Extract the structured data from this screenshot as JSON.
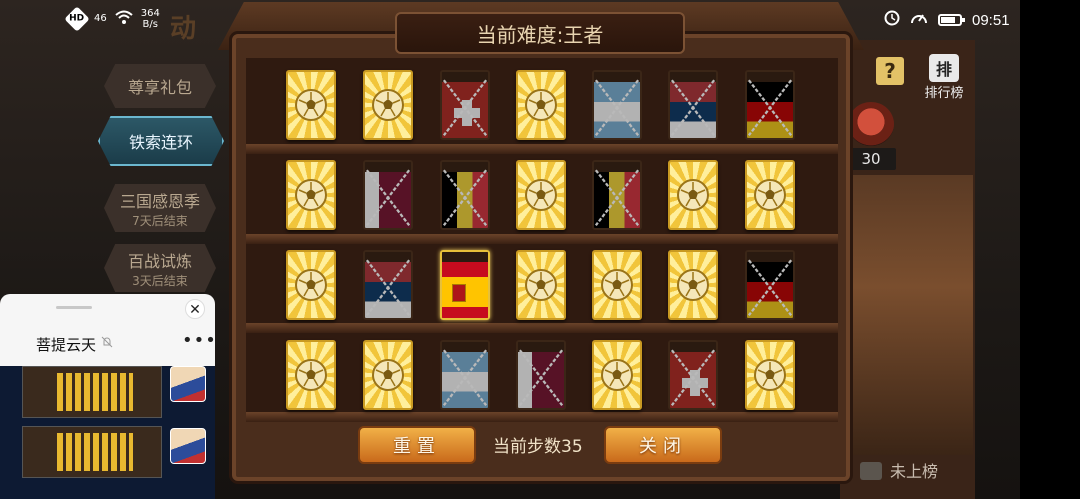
{
  "status_bar": {
    "hd": "HD",
    "signal": "46",
    "net_speed_value": "364",
    "net_speed_unit": "B/s",
    "time": "09:51"
  },
  "game": {
    "title_fragment": "动",
    "menu": [
      {
        "label": "尊享礼包",
        "sub": "",
        "active": false
      },
      {
        "label": "铁索连环",
        "sub": "",
        "active": true
      },
      {
        "label": "三国感恩季",
        "sub": "7天后结束",
        "active": false
      },
      {
        "label": "百战试炼",
        "sub": "3天后结束",
        "active": false
      }
    ],
    "help_label": "?",
    "rank_icon": "排",
    "rank_label": "排行榜",
    "chest_count": "30",
    "unranked_label": "未上榜"
  },
  "puzzle": {
    "title": "当前难度:王者",
    "grid": [
      [
        {
          "t": "ball"
        },
        {
          "t": "ball"
        },
        {
          "t": "flag",
          "c": "switzerland",
          "locked": true
        },
        {
          "t": "ball"
        },
        {
          "t": "flag",
          "c": "argentina",
          "locked": true
        },
        {
          "t": "flag",
          "c": "serbia",
          "locked": true
        },
        {
          "t": "flag",
          "c": "germany",
          "locked": true
        }
      ],
      [
        {
          "t": "ball"
        },
        {
          "t": "flag",
          "c": "qatar",
          "locked": true
        },
        {
          "t": "flag",
          "c": "belgium",
          "locked": true
        },
        {
          "t": "ball"
        },
        {
          "t": "flag",
          "c": "belgium",
          "locked": true
        },
        {
          "t": "ball"
        },
        {
          "t": "ball"
        }
      ],
      [
        {
          "t": "ball"
        },
        {
          "t": "flag",
          "c": "serbia",
          "locked": true
        },
        {
          "t": "flag",
          "c": "spain",
          "locked": false
        },
        {
          "t": "ball"
        },
        {
          "t": "ball"
        },
        {
          "t": "ball"
        },
        {
          "t": "flag",
          "c": "germany",
          "locked": true
        }
      ],
      [
        {
          "t": "ball"
        },
        {
          "t": "ball"
        },
        {
          "t": "flag",
          "c": "argentina",
          "locked": true
        },
        {
          "t": "flag",
          "c": "qatar",
          "locked": true
        },
        {
          "t": "ball"
        },
        {
          "t": "flag",
          "c": "switzerland",
          "locked": true
        },
        {
          "t": "ball"
        }
      ]
    ],
    "reset_label": "重置",
    "steps_label": "当前步数35",
    "close_label": "关闭"
  },
  "floating_window": {
    "title": "菩提云天",
    "close_symbol": "✕",
    "more_symbol": "•••"
  }
}
